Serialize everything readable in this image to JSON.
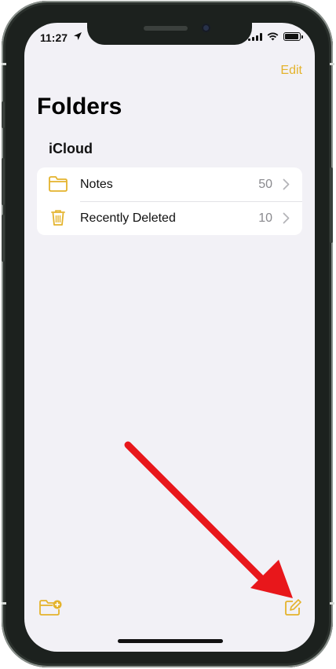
{
  "status_bar": {
    "time": "11:27"
  },
  "nav": {
    "edit_label": "Edit"
  },
  "page": {
    "title": "Folders"
  },
  "section": {
    "header": "iCloud"
  },
  "folders": [
    {
      "label": "Notes",
      "count": "50",
      "icon": "folder-icon"
    },
    {
      "label": "Recently Deleted",
      "count": "10",
      "icon": "trash-icon"
    }
  ],
  "toolbar": {
    "left_icon": "new-folder-icon",
    "right_icon": "compose-icon"
  },
  "colors": {
    "accent": "#e4b32c",
    "background": "#f2f1f6",
    "annotation_arrow": "#e8171b"
  }
}
